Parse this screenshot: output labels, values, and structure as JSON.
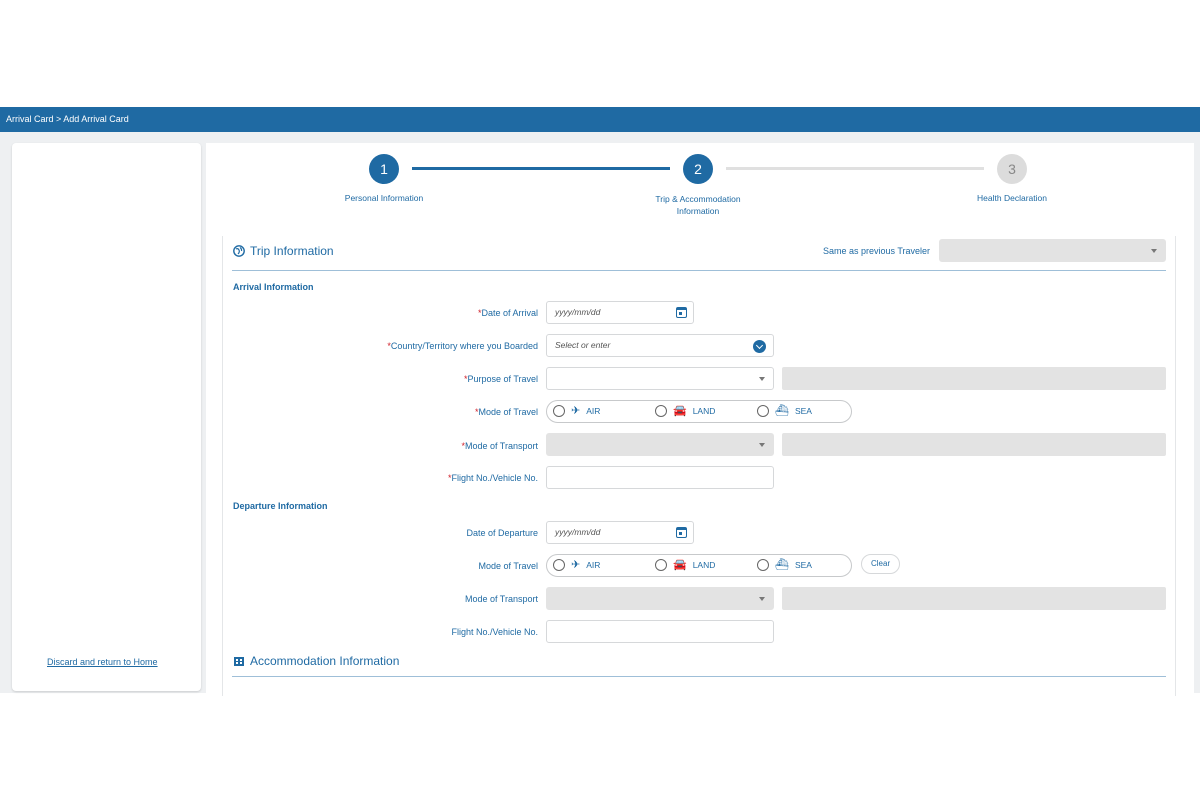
{
  "breadcrumb": "Arrival Card > Add Arrival Card",
  "sidebar": {
    "discard_link": "Discard and return to Home"
  },
  "stepper": {
    "steps": [
      {
        "number": "1",
        "label": "Personal Information",
        "state": "done"
      },
      {
        "number": "2",
        "label_line1": "Trip & Accommodation",
        "label_line2": "Information",
        "state": "active"
      },
      {
        "number": "3",
        "label": "Health Declaration",
        "state": "pending"
      }
    ]
  },
  "trip": {
    "title": "Trip Information",
    "same_as_label": "Same as previous Traveler",
    "arrival_heading": "Arrival Information",
    "departure_heading": "Departure Information",
    "date_of_arrival_label": "Date of Arrival",
    "date_placeholder": "yyyy/mm/dd",
    "country_label": "Country/Territory where you Boarded",
    "country_placeholder": "Select or enter",
    "purpose_label": "Purpose of Travel",
    "mode_travel_label": "Mode of Travel",
    "mode_transport_label": "Mode of Transport",
    "flight_label": "Flight No./Vehicle No.",
    "date_of_departure_label": "Date of Departure",
    "required_mark": "*",
    "options": {
      "air": "AIR",
      "land": "LAND",
      "sea": "SEA"
    },
    "clear_label": "Clear"
  },
  "accommodation": {
    "title": "Accommodation Information"
  },
  "colors": {
    "primary": "#1f6aa3",
    "required": "#d0202a",
    "disabled": "#e3e3e3"
  }
}
